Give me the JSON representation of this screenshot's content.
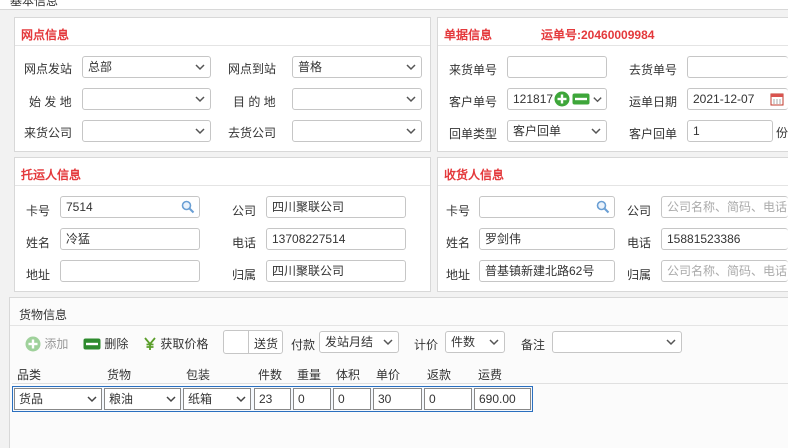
{
  "top_title": "基本信息",
  "outlet": {
    "title": "网点信息",
    "depart_label": "网点发站",
    "depart_value": "总部",
    "arrive_label": "网点到站",
    "arrive_value": "普格",
    "origin_label": "始 发 地",
    "origin_value": "",
    "dest_label": "目 的 地",
    "dest_value": "",
    "from_company_label": "来货公司",
    "from_company_value": "",
    "to_company_label": "去货公司",
    "to_company_value": ""
  },
  "receipt": {
    "title": "单据信息",
    "waybill_label": "运单号:",
    "waybill_no": "20460009984",
    "incoming_no_label": "来货单号",
    "incoming_no_value": "",
    "outgoing_no_label": "去货单号",
    "outgoing_no_value": "",
    "customer_no_label": "客户单号",
    "customer_no_value": "121817",
    "waybill_date_label": "运单日期",
    "waybill_date_value": "2021-12-07",
    "return_type_label": "回单类型",
    "return_type_value": "客户回单",
    "customer_return_label": "客户回单",
    "customer_return_value": "1",
    "customer_return_unit": "份"
  },
  "shipper": {
    "title": "托运人信息",
    "card_label": "卡号",
    "card_value": "7514",
    "company_label": "公司",
    "company_value": "四川聚联公司",
    "name_label": "姓名",
    "name_value": "冷猛",
    "phone_label": "电话",
    "phone_value": "13708227514",
    "address_label": "地址",
    "address_value": "",
    "belong_label": "归属",
    "belong_value": "四川聚联公司"
  },
  "consignee": {
    "title": "收货人信息",
    "card_label": "卡号",
    "card_value": "",
    "company_label": "公司",
    "company_placeholder": "公司名称、简码、电话",
    "name_label": "姓名",
    "name_value": "罗剑伟",
    "phone_label": "电话",
    "phone_value": "15881523386",
    "address_label": "地址",
    "address_value": "普基镇新建北路62号",
    "belong_label": "归属",
    "belong_placeholder": "公司名称、简码、电话"
  },
  "goods": {
    "title": "货物信息",
    "add_label": "添加",
    "delete_label": "删除",
    "price_label": "获取价格",
    "deliver_label": "送货",
    "pay_label": "付款",
    "pay_value": "发站月结",
    "calc_label": "计价",
    "calc_value": "件数",
    "note_label": "备注",
    "note_value": "",
    "columns": [
      "品类",
      "货物",
      "包装",
      "件数",
      "重量",
      "体积",
      "单价",
      "返款",
      "运费"
    ],
    "row": [
      "货品",
      "粮油",
      "纸箱",
      "23",
      "0",
      "0",
      "30",
      "0",
      "690.00"
    ]
  },
  "colors": {
    "accent_red": "#e4393c",
    "green": "#3ea63a",
    "row_border": "#2a6fbf"
  }
}
